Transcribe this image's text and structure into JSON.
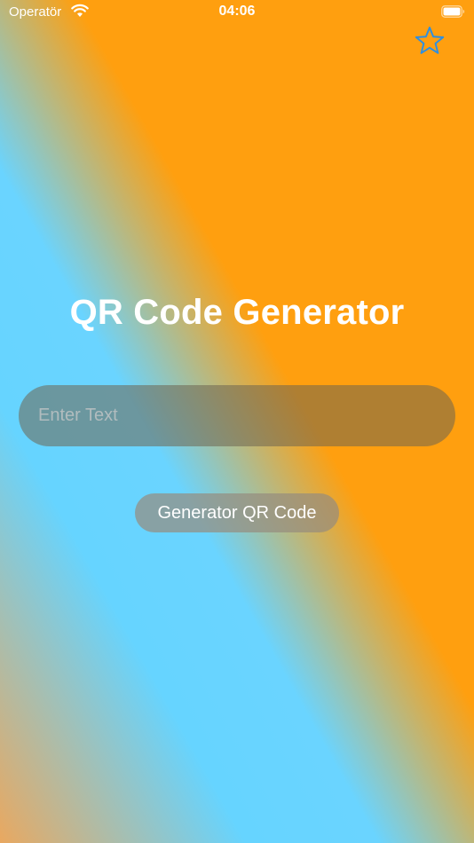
{
  "status_bar": {
    "carrier": "Operatör",
    "time": "04:06",
    "wifi_icon": "wifi-icon",
    "battery_icon": "battery-icon"
  },
  "nav": {
    "favorite_icon": "star-outline-icon",
    "accent_color": "#2f8fe0"
  },
  "main": {
    "title": "QR Code Generator",
    "input": {
      "placeholder": "Enter Text",
      "value": ""
    },
    "generate_button_label": "Generator QR Code"
  },
  "colors": {
    "gradient_orange": "#ff9f0f",
    "gradient_blue": "#66d4ff"
  }
}
